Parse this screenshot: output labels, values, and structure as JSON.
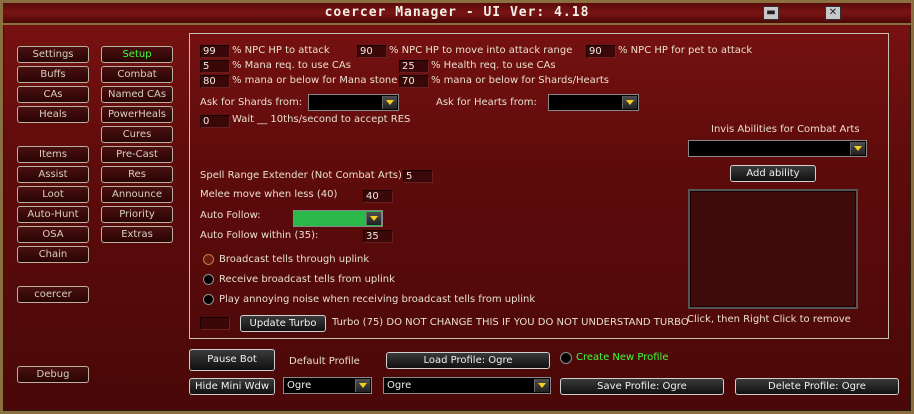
{
  "window": {
    "title": "coercer Manager  - UI Ver: 4.18",
    "minimize": "▬",
    "close": "✕"
  },
  "left_col": [
    "Settings",
    "Buffs",
    "CAs",
    "Heals",
    "Items",
    "Assist",
    "Loot",
    "Auto-Hunt",
    "OSA",
    "Chain",
    "coercer",
    "Debug"
  ],
  "mid_col": [
    "Setup",
    "Combat",
    "Named CAs",
    "PowerHeals",
    "Cures",
    "Pre-Cast",
    "Res",
    "Announce",
    "Priority",
    "Extras"
  ],
  "active_tab": "Setup",
  "settings": {
    "npc_hp_attack": {
      "value": "99",
      "label": "% NPC HP to attack"
    },
    "npc_hp_move": {
      "value": "90",
      "label": "% NPC HP to move into attack range"
    },
    "npc_hp_pet": {
      "value": "90",
      "label": "% NPC HP for pet to attack"
    },
    "mana_cas": {
      "value": "5",
      "label": "% Mana req. to use CAs"
    },
    "health_cas": {
      "value": "25",
      "label": "% Health req. to use CAs"
    },
    "mana_stone": {
      "value": "80",
      "label": "% mana or below for Mana stone"
    },
    "mana_shards": {
      "value": "70",
      "label": "% mana or below for Shards/Hearts"
    },
    "ask_shards_label": "Ask for Shards from:",
    "ask_hearts_label": "Ask for Hearts from:",
    "res_wait": {
      "value": "0",
      "label": "Wait __ 10ths/second to accept RES"
    },
    "spell_range": {
      "label": "Spell Range Extender (Not Combat Arts):",
      "value": "5"
    },
    "melee_move": {
      "label": "Melee move when less (40)",
      "value": "40"
    },
    "auto_follow_label": "Auto Follow:",
    "auto_follow_within": {
      "label": "Auto Follow within (35):",
      "value": "35"
    },
    "radio_broadcast": "Broadcast tells through uplink",
    "radio_receive": "Receive broadcast tells from uplink",
    "radio_noise": "Play annoying noise when receiving broadcast tells from uplink",
    "update_turbo_button": "Update Turbo",
    "turbo_note": "Turbo (75) DO NOT CHANGE THIS IF YOU DO NOT UNDERSTAND TURBO",
    "invis_label": "Invis Abilities for Combat Arts",
    "add_ability_button": "Add ability",
    "remove_hint": "Click, then Right Click to remove"
  },
  "bottom": {
    "pause_bot": "Pause Bot",
    "hide_mini": "Hide Mini Wdw",
    "default_profile_label": "Default Profile",
    "default_profile_value": "Ogre",
    "load_profile": "Load Profile: Ogre",
    "create_new_profile": "Create New Profile",
    "profile_select_value": "Ogre",
    "save_profile": "Save Profile: Ogre",
    "delete_profile": "Delete Profile: Ogre"
  },
  "colors": {
    "accent_green": "#3cff3c",
    "follow_swatch": "#2ab84a",
    "frame_red": "#5e0b0b"
  }
}
